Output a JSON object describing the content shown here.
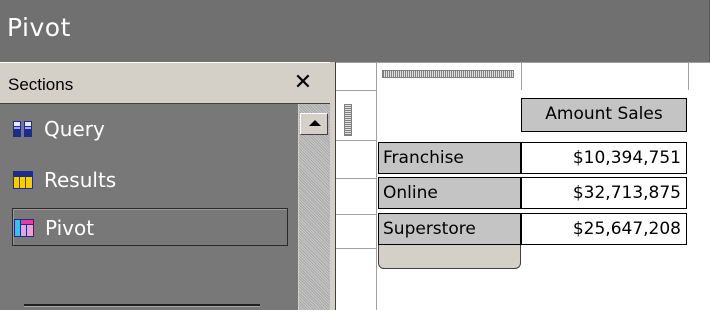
{
  "window": {
    "title": "Pivot"
  },
  "sections": {
    "header_label": "Sections",
    "close_glyph": "✕",
    "items": [
      {
        "label": "Query",
        "icon": "query-icon",
        "selected": false
      },
      {
        "label": "Results",
        "icon": "results-table-icon",
        "selected": false
      },
      {
        "label": "Pivot",
        "icon": "pivot-table-icon",
        "selected": true
      }
    ]
  },
  "pivot": {
    "column_header": "Amount Sales",
    "rows": [
      {
        "label": "Franchise",
        "value": "$10,394,751"
      },
      {
        "label": "Online",
        "value": "$32,713,875"
      },
      {
        "label": "Superstore",
        "value": "$25,647,208"
      }
    ]
  },
  "colors": {
    "titlebar": "#707070",
    "panel": "#787878",
    "chrome": "#d4d0c8",
    "cell_header": "#c4c4c4"
  }
}
